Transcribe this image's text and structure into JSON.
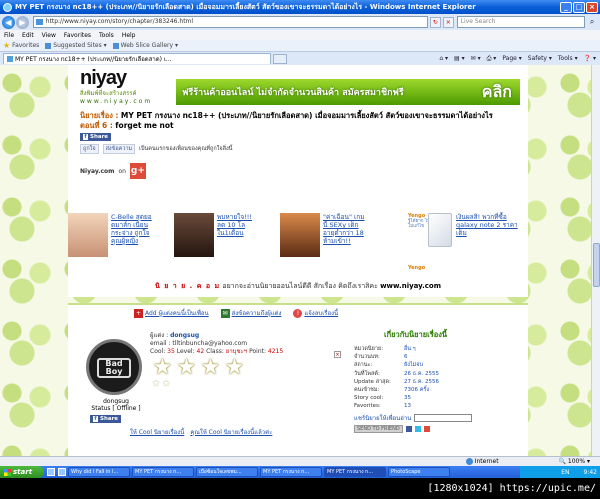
{
  "window": {
    "title": "MY PET กรงนาง nc18++ (ประเภท//นิยายรักเลือดสาด) เมื่อจอมมารเลี้ยงสัตว์ สัตว์ของเขาจะธรรมดาได้อย่างไร - Windows Internet Explorer",
    "min": "_",
    "max": "□",
    "close": "×"
  },
  "address": {
    "back": "◀",
    "forward": "▶",
    "url": "http://www.niyay.com/story/chapter/383246.html",
    "refresh": "↻",
    "stop": "×",
    "search_placeholder": "Live Search",
    "search_icon": "⌕"
  },
  "menu": [
    "File",
    "Edit",
    "View",
    "Favorites",
    "Tools",
    "Help"
  ],
  "favorites_bar": {
    "label": "Favorites",
    "items": [
      "Suggested Sites ▾",
      "Web Slice Gallery ▾"
    ]
  },
  "tab": {
    "label": "MY PET กรงนาง nc18++ (ประเภท//นิยายรักเลือดสาด) เ...",
    "commands": [
      "⌂ ▾",
      "▤ ▾",
      "✉ ▾",
      "⎙ ▾",
      "Page ▾",
      "Safety ▾",
      "Tools ▾",
      "❓ ▾"
    ]
  },
  "banner": {
    "logo": "niyay",
    "logo_tag": "สิ่งพิมพ์ที่จะสร้างสรรค์",
    "logo_url": "www.niyay.com",
    "promo": "ฟรีร้านค้าออนไลน์ ไม่จำกัดจำนวนสินค้า สมัครสมาชิกฟรี",
    "promo_click": "คลิก"
  },
  "novel": {
    "title_label": "นิยายเรื่อง :",
    "title": "MY PET กรงนาง nc18++ (ประเภท//นิยายรักเลือดสาด) เมื่อจอมมารเลี้ยงสัตว์ สัตว์ของเขาจะธรรมดาได้อย่างไร",
    "chapter_label": "ตอนที่ 6 :",
    "chapter": "forget me not"
  },
  "share": {
    "fb_share": "Share",
    "like": "ถูกใจ",
    "send": "ส่งข้อความ",
    "like_text": "เป็นคนแรกของเพื่อนของคุณที่ถูกใจสิ่งนี้",
    "niyay_on": "Niyay.com",
    "on_word": "on",
    "gplus": "g+"
  },
  "ads": [
    {
      "text": "C-Belle สุดยอดมาส์ก เนียนกระจ่าง ถูกใจคุณผู้หญิง",
      "thumb_color": "#e8c2a2"
    },
    {
      "text": "พบหายใจ!!! ลด 10 โล ใน1เดือน",
      "thumb_color": "#3a2418"
    },
    {
      "text": "\"ค่าเฉือน\" เกมนี้ SEXy เด็กอายุต่ำกว่า 18 ห้ามเข้า!!",
      "thumb_color": "#a2502a"
    },
    {
      "text": "เงินผลสิ! พวกที่ซื้อ galaxy note 2 ราคาเต็ม"
    }
  ],
  "yengo": {
    "title": "Yengo",
    "sub": "รู้ได้ยาก ไป๋ ปัญหาไม่แก้ไข",
    "foot": "Yengo"
  },
  "footline": {
    "site": "นิ ย า ย . ค อ ม",
    "text": "อยากจะอ่านนิยายออนไลน์ดีดี สักเรื่อง คิดถึงเราสิคะ",
    "domain": "www.niyay.com"
  },
  "actions": [
    {
      "label": "Add ผู้แต่งคนนี้เป็นเพื่อน",
      "icon": "+"
    },
    {
      "label": "ส่งข้อความถึงผู้แต่ง",
      "icon": "✉"
    },
    {
      "label": "แจ้งลบเรื่องนี้",
      "icon": "!"
    }
  ],
  "author": {
    "avatar_text": "Bad Boy",
    "name_label": "ผู้แต่ง :",
    "name": "dongsug",
    "email_label": "email :",
    "email": "tlltinbuncha@yahoo.com",
    "cool_label": "Cool:",
    "cool": "35",
    "level_label": "Level:",
    "level": "42",
    "class_label": "Class:",
    "class": "ยาบุชะฯ",
    "point_label": "Point:",
    "point": "4215",
    "display_name": "dongsug",
    "status": "Status [ Offline ]",
    "big_stars": 4,
    "small_stars": 2,
    "link1": "ให้ Cool นิยายเรื่องนี้",
    "link2": "คุณให้ Cool นิยายเรื่องนี้แล้วค่ะ",
    "close_icon": "×"
  },
  "stats": {
    "heading": "เกี่ยวกับนิยายเรื่องนี้",
    "rows": [
      {
        "k": "หมวดนิยาย:",
        "v": "อื่น ๆ"
      },
      {
        "k": "จำนวนบท:",
        "v": "6"
      },
      {
        "k": "สถานะ:",
        "v": "ยังไม่จบ"
      },
      {
        "k": "วันที่โพสต์:",
        "v": "26 ธ.ค. 2555"
      },
      {
        "k": "Update ล่าสุด:",
        "v": "27 ธ.ค. 2556"
      },
      {
        "k": "คนเข้าชม:",
        "v": "7306 ครั้ง"
      },
      {
        "k": "Story cool:",
        "v": "35"
      },
      {
        "k": "Favorites:",
        "v": "13"
      }
    ],
    "tell_label": "แชร์นิยายให้เพื่อนอ่าน",
    "send_button": "SEND TO FRIEND"
  },
  "statusbar": {
    "zone": "Internet",
    "zoom": "🔍 100% ▾"
  },
  "taskbar": {
    "start": "start",
    "tasks": [
      "Why did I Fall in l...",
      "MY PET กรงนาง n...",
      "เบื่อ่ซ้อนใจเลขพม...",
      "MY PET กรงนาง n...",
      "MY PET กรงนาง n...",
      "PhotoScape"
    ],
    "lang": "EN",
    "clock": "9:42"
  },
  "caption": "[1280x1024] https://upic.me/"
}
